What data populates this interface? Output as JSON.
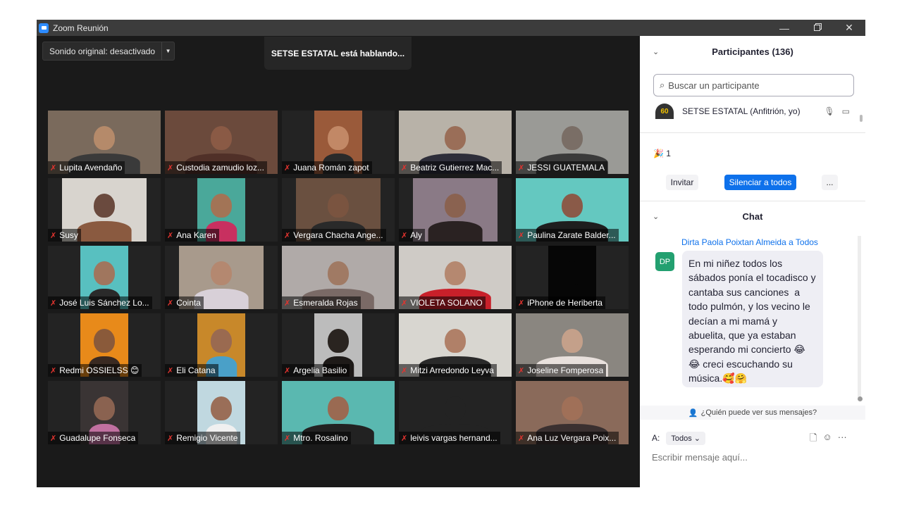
{
  "window": {
    "title": "Zoom Reunión",
    "minimize": "—",
    "close": "✕"
  },
  "video": {
    "audio_label": "Sonido original: desactivado",
    "audio_arrow": "▼",
    "speaking": "SETSE ESTATAL está hablando...",
    "mic_glyph": "✗",
    "participants": [
      {
        "name": "Lupita Avendaño",
        "bg": "#7a6a5c",
        "skin": "#b58a6a",
        "shirt": "#3a3a3a",
        "feed": "full"
      },
      {
        "name": "Custodia zamudio loz...",
        "bg": "#6b4a3c",
        "skin": "#8a5a45",
        "shirt": "#503028",
        "feed": "full"
      },
      {
        "name": "Juana Román zapot",
        "bg": "#9a5a3a",
        "skin": "#c28866",
        "shirt": "#2a2a2a",
        "feed": "narrow"
      },
      {
        "name": "Beatriz Gutierrez Mac...",
        "bg": "#b8b2a8",
        "skin": "#9a6e58",
        "shirt": "#2e2e3a",
        "feed": "full"
      },
      {
        "name": "JESSI GUATEMALA",
        "bg": "#9a9a96",
        "skin": "#7a6e66",
        "shirt": "#3a3a3a",
        "feed": "full"
      },
      {
        "name": "Susy",
        "bg": "#d8d4ce",
        "skin": "#6a4a3e",
        "shirt": "#8a5a40",
        "feed": "mid"
      },
      {
        "name": "Ana Karen",
        "bg": "#4aa89a",
        "skin": "#a27456",
        "shirt": "#c83060",
        "feed": "narrow"
      },
      {
        "name": "Vergara Chacha Ange...",
        "bg": "#6a5040",
        "skin": "#7a5440",
        "shirt": "#2a2a2a",
        "feed": "mid"
      },
      {
        "name": "Aly",
        "bg": "#8a7a86",
        "skin": "#8a6250",
        "shirt": "#2a2222",
        "feed": "mid"
      },
      {
        "name": "Paulina Zarate Balder...",
        "bg": "#64c8c0",
        "skin": "#8a5a48",
        "shirt": "#1e1e1e",
        "feed": "full"
      },
      {
        "name": "José Luis Sánchez Lo...",
        "bg": "#58c0c0",
        "skin": "#a0765e",
        "shirt": "#2a2a2a",
        "feed": "narrow"
      },
      {
        "name": "Cointa",
        "bg": "#a89a8c",
        "skin": "#b48870",
        "shirt": "#d8d0d8",
        "feed": "mid"
      },
      {
        "name": "Esmeralda Rojas",
        "bg": "#b0aaa8",
        "skin": "#a07a64",
        "shirt": "#7a6a66",
        "feed": "full"
      },
      {
        "name": "VIOLETA SOLANO",
        "bg": "#cfcbc6",
        "skin": "#b58870",
        "shirt": "#c8202a",
        "feed": "full"
      },
      {
        "name": "iPhone de Heriberta",
        "bg": "#060606",
        "skin": "#060606",
        "shirt": "#060606",
        "feed": "narrow"
      },
      {
        "name": "Redmi OSSIELSS 😊",
        "bg": "#e88a1a",
        "skin": "#8a5a3a",
        "shirt": "#3a2a22",
        "feed": "narrow"
      },
      {
        "name": "Eli Catana",
        "bg": "#c8882a",
        "skin": "#9a6a50",
        "shirt": "#4aa0c8",
        "feed": "narrow"
      },
      {
        "name": "Argelia Basilio",
        "bg": "#bcbcbc",
        "skin": "#2a2420",
        "shirt": "#1e1a18",
        "feed": "narrow"
      },
      {
        "name": "Mitzi Arredondo Leyva",
        "bg": "#d8d6d0",
        "skin": "#b08068",
        "shirt": "#2a2a2a",
        "feed": "full"
      },
      {
        "name": "Joseline Fomperosa",
        "bg": "#8a8680",
        "skin": "#c4a08a",
        "shirt": "#e8e0dc",
        "feed": "full"
      },
      {
        "name": "Guadalupe Fonseca",
        "bg": "#3a3434",
        "skin": "#8a6250",
        "shirt": "#c070a0",
        "feed": "narrow"
      },
      {
        "name": "Remigio Vicente",
        "bg": "#c0d8e0",
        "skin": "#9a6e58",
        "shirt": "#f0f0f0",
        "feed": "narrow"
      },
      {
        "name": "Mtro. Rosalino",
        "bg": "#5ab8b0",
        "skin": "#9a6a52",
        "shirt": "#222222",
        "feed": "full"
      },
      {
        "name": "leivis vargas hernand...",
        "bg": "#232323",
        "skin": "#232323",
        "shirt": "#232323",
        "feed": "full"
      },
      {
        "name": "Ana Luz Vergara Poix...",
        "bg": "#8a6a5a",
        "skin": "#a07058",
        "shirt": "#3a3030",
        "feed": "full"
      }
    ]
  },
  "participants_panel": {
    "chevron": "⌄",
    "title": "Participantes (136)",
    "search_placeholder": "Buscar un participante",
    "search_icon": "search-icon",
    "host": {
      "badge": "60",
      "name": "SETSE ESTATAL (Anfitrión, yo)"
    },
    "reaction_text": "🎉 1",
    "invite": "Invitar",
    "mute_all": "Silenciar a todos",
    "more": "..."
  },
  "chat_panel": {
    "title": "Chat",
    "sender": "Dirta Paola Poixtan Almeida",
    "to_word": "a",
    "recipient": "Todos",
    "avatar_initials": "DP",
    "message": "En mi niñez todos los sábados ponía el tocadisco y cantaba sus canciones  a todo pulmón, y los vecino le decían a mi mamá y abuelita, que ya estaban esperando mi concierto 😂😂 creci escuchando su música.🥰🤗",
    "who_can_see": "¿Quién puede ver sus mensajes?",
    "to_label": "A:",
    "to_value": "Todos ⌄",
    "input_placeholder": "Escribir mensaje aquí..."
  },
  "colors": {
    "accent": "#0e71eb",
    "muted_mic": "#e3342f",
    "meeting_bg": "#1a1a1a"
  }
}
